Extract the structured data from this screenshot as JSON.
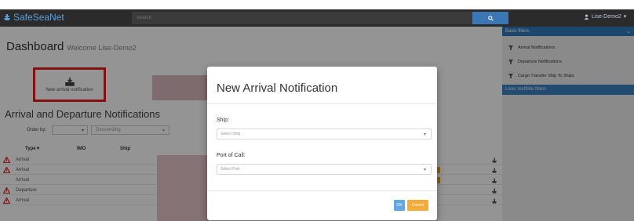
{
  "navbar": {
    "brand": "SafeSeaNet",
    "search_placeholder": "Search",
    "user": "Lise-Demo2"
  },
  "dashboard": {
    "title": "Dashboard",
    "welcome": "Welcome Lise-Demo2",
    "new_arrival_label": "New arrival notification",
    "section_title": "Arrival and Departure Notifications",
    "order_by_label": "Order by:",
    "order_direction": "Descending"
  },
  "table": {
    "headers": [
      "Type",
      "IMO",
      "Ship"
    ],
    "rows": [
      {
        "type": "Arrival",
        "warning": true
      },
      {
        "type": "Arrival",
        "warning": true
      },
      {
        "type": "Arrival",
        "warning": false
      },
      {
        "type": "Departure",
        "warning": true
      },
      {
        "type": "Arrival",
        "warning": true
      }
    ]
  },
  "filters": {
    "basic_header": "Basic filters",
    "items": [
      "Arrival Notifications",
      "Departure Notifications",
      "Cargo Transfer Ship To Ships"
    ],
    "user_header": "Lises testfilde filters"
  },
  "modal": {
    "title": "New Arrival Notification",
    "ship_label": "Ship:",
    "ship_placeholder": "Select Ship",
    "port_label": "Port of Call:",
    "port_placeholder": "Select Port",
    "ok_label": "OK",
    "cancel_label": "Cancel"
  },
  "colors": {
    "accent": "#2f7bc0",
    "highlight": "#e02020",
    "warning": "#d93030",
    "cancel": "#f5ab3c"
  }
}
